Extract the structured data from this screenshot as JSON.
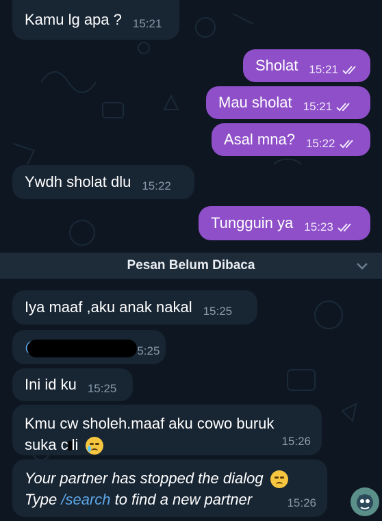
{
  "colors": {
    "background": "#0e1621",
    "incoming_bubble": "#182533",
    "outgoing_bubble": "#8e4fc9",
    "timestamp_in": "#8b9aa8",
    "link": "#5ea8e7",
    "banner_bg": "#1e2c3a"
  },
  "messages": [
    {
      "direction": "incoming",
      "text": "Kamu lg apa ?",
      "time": "15:21"
    },
    {
      "direction": "outgoing",
      "text": "Sholat",
      "time": "15:21",
      "status": "read"
    },
    {
      "direction": "outgoing",
      "text": "Mau sholat",
      "time": "15:21",
      "status": "read"
    },
    {
      "direction": "outgoing",
      "text": "Asal mna?",
      "time": "15:22",
      "status": "read"
    },
    {
      "direction": "incoming",
      "text": "Ywdh sholat dlu",
      "time": "15:22"
    },
    {
      "direction": "outgoing",
      "text": "Tungguin ya",
      "time": "15:23",
      "status": "read"
    },
    {
      "direction": "incoming",
      "text": "Iya maaf ,aku anak nakal",
      "time": "15:25"
    },
    {
      "direction": "incoming",
      "text": "@",
      "time": "5:25",
      "redacted": true
    },
    {
      "direction": "incoming",
      "text": "Ini id ku",
      "time": "15:25"
    },
    {
      "direction": "incoming",
      "line1": "Kmu cw sholeh.maaf aku cowo buruk",
      "line2": "suka c",
      "line2_b": "li",
      "time": "15:26",
      "emoji": "crying-face"
    },
    {
      "direction": "incoming",
      "italic": true,
      "line1": "Your partner has stopped the dialog",
      "line2_prefix": "Type ",
      "command": "/search",
      "line2_suffix": " to find a new partner",
      "time": "15:26",
      "emoji": "disappointed-face"
    }
  ],
  "banner": {
    "label": "Pesan Belum Dibaca",
    "icon": "chevron-down-icon"
  },
  "fab": {
    "icon": "bot-avatar-icon"
  }
}
